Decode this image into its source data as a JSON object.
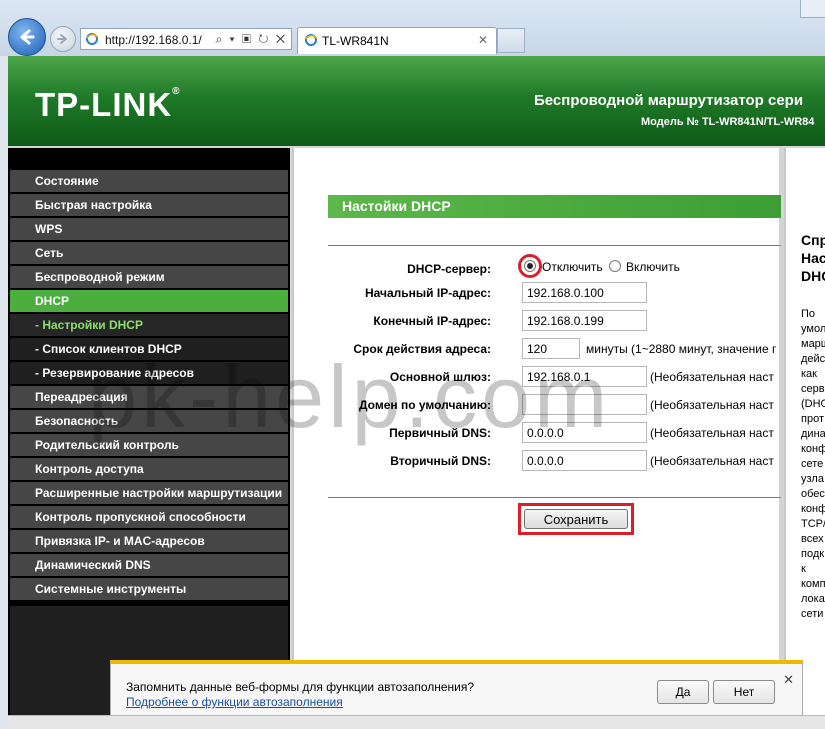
{
  "browser": {
    "url": "http://192.168.0.1/",
    "address_tools": "⌕ ▾ ▣ ↻ ✕",
    "tab_title": "TL-WR841N",
    "tab_close": "✕"
  },
  "banner": {
    "logo": "TP-LINK",
    "logo_mark": "®",
    "title": "Беспроводной маршрутизатор сери",
    "model": "Модель № TL-WR841N/TL-WR84"
  },
  "menu": {
    "items": [
      {
        "label": "Состояние"
      },
      {
        "label": "Быстрая настройка"
      },
      {
        "label": "WPS"
      },
      {
        "label": "Сеть"
      },
      {
        "label": "Беспроводной режим"
      },
      {
        "label": "DHCP"
      },
      {
        "label": "- Настройки DHCP"
      },
      {
        "label": "- Список клиентов DHCP"
      },
      {
        "label": "- Резервирование адресов"
      },
      {
        "label": "Переадресация"
      },
      {
        "label": "Безопасность"
      },
      {
        "label": "Родительский контроль"
      },
      {
        "label": "Контроль доступа"
      },
      {
        "label": "Расширенные настройки маршрутизации"
      },
      {
        "label": "Контроль пропускной способности"
      },
      {
        "label": "Привязка IP- и MAC-адресов"
      },
      {
        "label": "Динамический DNS"
      },
      {
        "label": "Системные инструменты"
      }
    ]
  },
  "form": {
    "section_title": "Настойки DHCP",
    "server_label": "DHCP-сервер:",
    "disable_label": "Отключить",
    "enable_label": "Включить",
    "selected": "Отключить",
    "start_ip_label": "Начальный IP-адрес:",
    "start_ip": "192.168.0.100",
    "end_ip_label": "Конечный IP-адрес:",
    "end_ip": "192.168.0.199",
    "lease_label": "Срок действия адреса:",
    "lease": "120",
    "lease_note": "минуты (1~2880 минут, значение г",
    "gateway_label": "Основной шлюз:",
    "gateway": "192.168.0.1",
    "optional_note": "(Необязательная наст",
    "domain_label": "Домен по умолчанию:",
    "domain": "",
    "dns1_label": "Первичный DNS:",
    "dns1": "0.0.0.0",
    "dns2_label": "Вторичный DNS:",
    "dns2": "0.0.0.0",
    "save_label": "Сохранить"
  },
  "help": {
    "h1": "Спр",
    "h2": "Нас",
    "h3": "DHC",
    "lines": [
      "По",
      "умол",
      "марш",
      "дейс",
      "как",
      "серв",
      "(DHC",
      "прот",
      "дина",
      "конф",
      "сете",
      "узла",
      "обес",
      "конф",
      "TCP/",
      "всех",
      "подк",
      "к",
      "комп",
      "лока",
      "сети"
    ]
  },
  "watermark": "pk-help.com",
  "notification": {
    "message": "Запомнить данные веб-формы для функции автозаполнения?",
    "link": "Подробнее о функции автозаполнения",
    "yes": "Да",
    "no": "Нет",
    "close": "✕"
  },
  "colors": {
    "brand_green": "#4cae3f",
    "highlight_red": "#d9202a",
    "notification_accent": "#f2b800"
  }
}
